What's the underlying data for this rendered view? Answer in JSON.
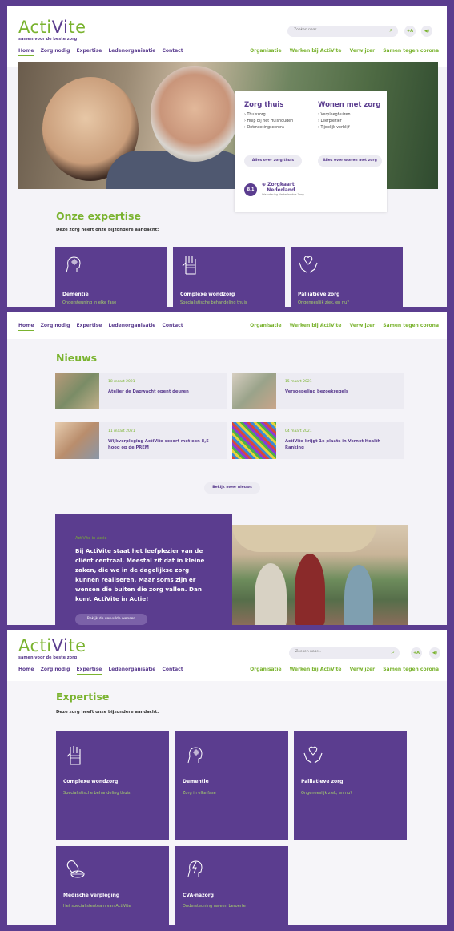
{
  "brand": {
    "name_a": "Acti",
    "name_b": "Vi",
    "name_c": "te",
    "tagline": "samen voor de beste zorg"
  },
  "header": {
    "search_placeholder": "Zoeken naar...",
    "font_btn": "+A",
    "sound_btn": "◀)"
  },
  "nav": {
    "main": [
      "Home",
      "Zorg nodig",
      "Expertise",
      "Ledenorganisatie",
      "Contact"
    ],
    "secondary": [
      "Organisatie",
      "Werken bij ActiVite",
      "Verwijzer",
      "Samen tegen corona"
    ]
  },
  "hero": {
    "col1": {
      "title": "Zorg thuis",
      "items": [
        "Thuiszorg",
        "Hulp bij het Huishouden",
        "Ontmoetingscentra"
      ],
      "button": "Alles over zorg thuis"
    },
    "col2": {
      "title": "Wonen met zorg",
      "items": [
        "Verpleeghuizen",
        "Leefplezier",
        "Tijdelijk verblijf"
      ],
      "button": "Alles over wonen met zorg"
    },
    "rating": "8,1",
    "zorgkaart": "Zorgkaart",
    "zorgkaart2": "Nederland",
    "zorgkaart_sub": "Waardering Nederlandse Zorg"
  },
  "home_expertise": {
    "title": "Onze expertise",
    "subtitle": "Deze zorg heeft onze bijzondere aandacht:",
    "tiles": [
      {
        "title": "Dementie",
        "sub": "Ondersteuning in elke fase"
      },
      {
        "title": "Complexe wondzorg",
        "sub": "Specialistische behandeling thuis"
      },
      {
        "title": "Palliatieve zorg",
        "sub": "Ongeneeslijk ziek, en nu?"
      }
    ]
  },
  "news": {
    "title": "Nieuws",
    "items": [
      {
        "date": "18 maart 2021",
        "title": "Atelier de Dagwacht opent deuren"
      },
      {
        "date": "15 maart 2021",
        "title": "Versoepeling bezoekregels"
      },
      {
        "date": "11 maart 2021",
        "title": "Wijkverpleging ActiVite scoort met een 8,5 hoog op de PREM"
      },
      {
        "date": "04 maart 2021",
        "title": "ActiVite krijgt 1e plaats in Vernet Health Ranking"
      }
    ],
    "more_button": "Bekijk meer nieuws"
  },
  "actie": {
    "label": "ActiVite in Actie",
    "text": "Bij ActiVite staat het leefplezier van de cliënt centraal. Meestal zit dat in kleine zaken, die we in de dagelijkse zorg kunnen realiseren. Maar soms zijn er wensen die buiten die zorg vallen. Dan komt ActiVite in Actie!",
    "button": "Bekijk de vervulde wensen"
  },
  "expertise_page": {
    "title": "Expertise",
    "subtitle": "Deze zorg heeft onze bijzondere aandacht:",
    "tiles": [
      {
        "title": "Complexe wondzorg",
        "sub": "Specialistische behandeling thuis"
      },
      {
        "title": "Dementie",
        "sub": "Zorg in elke fase"
      },
      {
        "title": "Palliatieve zorg",
        "sub": "Ongeneeslijk ziek, en nu?"
      },
      {
        "title": "Medische verpleging",
        "sub": "Het specialistenteam van ActiVite"
      },
      {
        "title": "CVA-nazorg",
        "sub": "Ondersteuning na een beroerte"
      }
    ]
  },
  "colors": {
    "purple": "#5b3d8f",
    "green": "#7ab32f",
    "light": "#ecebf2"
  }
}
